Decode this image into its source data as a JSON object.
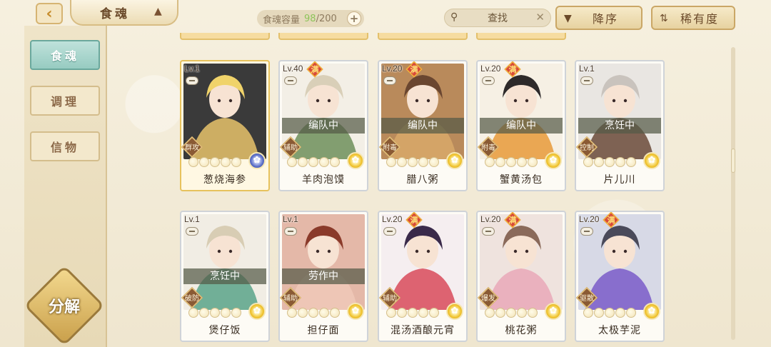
{
  "header": {
    "title": "食魂",
    "capacity_label": "食魂容量",
    "capacity_current": "98",
    "capacity_max": "/200",
    "search_label": "查找",
    "sort_order": "降序",
    "sort_by": "稀有度"
  },
  "nav": {
    "items": [
      {
        "label": "食魂",
        "active": true
      },
      {
        "label": "调理",
        "active": false
      },
      {
        "label": "信物",
        "active": false
      }
    ],
    "decompose": "分解"
  },
  "cards": [
    {
      "level": "Lv.1",
      "full": false,
      "status": "",
      "role": "群攻",
      "name": "葱烧海参",
      "stars_filled": 0,
      "element": "blue",
      "gold": true
    },
    {
      "level": "Lv.40",
      "full": true,
      "full_label": "满",
      "status": "编队中",
      "role": "辅助",
      "name": "羊肉泡馍",
      "stars_filled": 0,
      "element": "gold",
      "gold": false
    },
    {
      "level": "Lv.20",
      "full": true,
      "full_label": "满",
      "status": "编队中",
      "role": "附毒",
      "name": "腊八粥",
      "stars_filled": 0,
      "element": "gold",
      "gold": false
    },
    {
      "level": "Lv.20",
      "full": true,
      "full_label": "满",
      "status": "编队中",
      "role": "附毒",
      "name": "蟹黄汤包",
      "stars_filled": 0,
      "element": "gold",
      "gold": false
    },
    {
      "level": "Lv.1",
      "full": false,
      "status": "烹饪中",
      "role": "控制",
      "name": "片儿川",
      "stars_filled": 0,
      "element": "gold",
      "gold": false
    },
    {
      "level": "Lv.1",
      "full": false,
      "status": "烹饪中",
      "role": "破防",
      "name": "煲仔饭",
      "stars_filled": 0,
      "element": "gold",
      "gold": false
    },
    {
      "level": "Lv.1",
      "full": false,
      "status": "劳作中",
      "role": "辅助",
      "name": "担仔面",
      "stars_filled": 0,
      "element": "gold",
      "gold": false
    },
    {
      "level": "Lv.20",
      "full": true,
      "full_label": "满",
      "status": "",
      "role": "辅助",
      "name": "混汤酒酿元宵",
      "stars_filled": 0,
      "element": "gold",
      "gold": false
    },
    {
      "level": "Lv.20",
      "full": true,
      "full_label": "满",
      "status": "",
      "role": "爆发",
      "name": "桃花粥",
      "stars_filled": 0,
      "element": "gold",
      "gold": false
    },
    {
      "level": "Lv.20",
      "full": true,
      "full_label": "满",
      "status": "",
      "role": "驱散",
      "name": "太极芋泥",
      "stars_filled": 0,
      "element": "gold",
      "gold": false
    }
  ],
  "colors": {
    "accent_teal": "#97cbc1",
    "gold_border": "#e7c25d",
    "full_badge": "#d84a3a",
    "capacity_current": "#8ec45a"
  }
}
